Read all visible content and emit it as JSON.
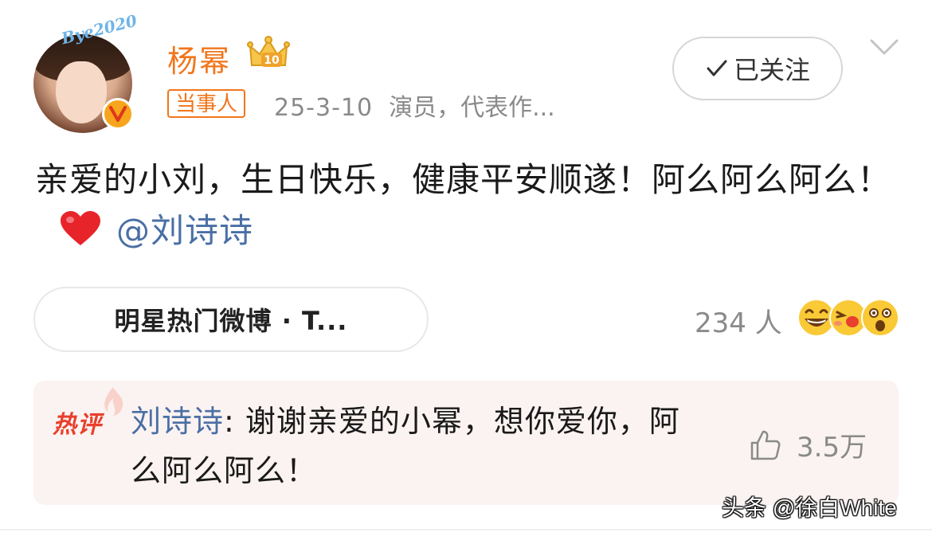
{
  "header": {
    "avatar_text": "Bye2020",
    "username": "杨幂",
    "tag": "当事人",
    "date": "25-3-10",
    "bio": "演员，代表作..."
  },
  "follow": {
    "label": "已关注"
  },
  "post": {
    "text": "亲爱的小刘，生日快乐，健康平安顺遂！阿么阿么阿么！",
    "mention": "@刘诗诗"
  },
  "topic": {
    "label": "明星热门微博 · T..."
  },
  "reactions": {
    "count": "234 人"
  },
  "hot_comment": {
    "label": "热评",
    "author": "刘诗诗",
    "text": ": 谢谢亲爱的小幂，想你爱你，阿么阿么阿么！",
    "likes": "3.5万"
  },
  "watermark": "头条 @徐白White",
  "colors": {
    "accent_orange": "#f1761c",
    "mention_blue": "#4a6fa5",
    "hot_red": "#e8402c",
    "comment_bg": "#fbf3f1"
  },
  "icons": [
    "crown-icon",
    "verified-badge-icon",
    "check-icon",
    "chevron-down-icon",
    "heart-icon",
    "grin-emoji-icon",
    "kiss-emoji-icon",
    "surprised-emoji-icon",
    "flame-icon",
    "thumbs-up-icon"
  ]
}
